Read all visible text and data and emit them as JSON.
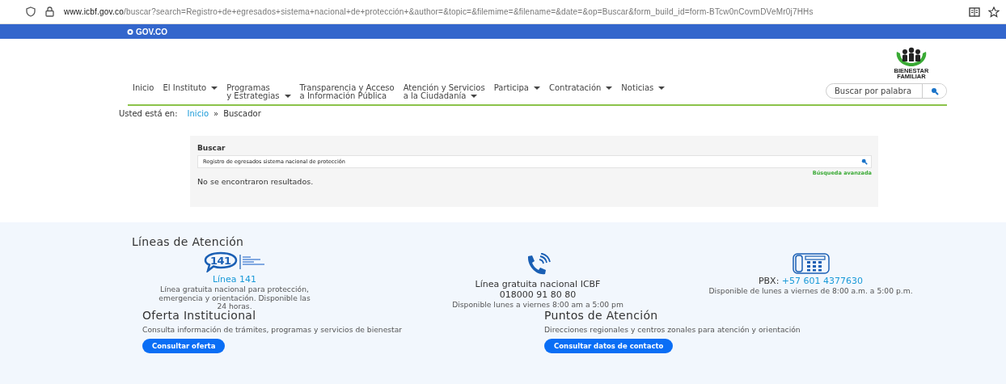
{
  "browser": {
    "url_domain": "www.icbf.gov.co",
    "url_rest": "/buscar?search=Registro+de+egresados+sistema+nacional+de+protección+&author=&topic=&filemime=&filename=&date=&op=Buscar&form_build_id=form-BTcw0nCovmDVeMr0j7HHs"
  },
  "gov_bar": {
    "logo_text": "GOV.CO"
  },
  "header": {
    "logo_text": "BIENESTAR FAMILIAR"
  },
  "nav": {
    "items": [
      {
        "label": "Inicio",
        "dropdown": false
      },
      {
        "label": "El Instituto",
        "dropdown": true
      },
      {
        "label": "Programas\ny Estrategias",
        "dropdown": true
      },
      {
        "label": "Transparencia y Acceso\na Información Pública",
        "dropdown": false
      },
      {
        "label": "Atención y Servicios\na la Ciudadanía",
        "dropdown": true
      },
      {
        "label": "Participa",
        "dropdown": true
      },
      {
        "label": "Contratación",
        "dropdown": true
      },
      {
        "label": "Noticias",
        "dropdown": true
      }
    ],
    "search_placeholder": "Buscar por palabra"
  },
  "breadcrumb": {
    "label": "Usted está en:",
    "items": [
      {
        "text": "Inicio",
        "link": true
      },
      {
        "text": "»",
        "link": false
      },
      {
        "text": "Buscador",
        "link": false
      }
    ]
  },
  "search_panel": {
    "title": "Buscar",
    "value": "Registro de egresados sistema nacional de protección",
    "advanced_link": "Búsqueda avanzada",
    "message": "No se encontraron resultados."
  },
  "footer": {
    "lines_title": "Líneas de Atención",
    "lines": [
      {
        "kind": "logo141",
        "logo_text": "141",
        "title_link": "Línea 141",
        "description": "Línea gratuita nacional para protección, emergencia y orientación. Disponible las 24 horas."
      },
      {
        "kind": "phone",
        "title": "Línea gratuita nacional ICBF",
        "number": "018000 91 80 80",
        "description": "Disponible lunes a viernes 8:00 am a 5:00 pm"
      },
      {
        "kind": "pbx",
        "title": "PBX: ",
        "title_link": "+57 601 4377630",
        "description": "Disponible de lunes a viernes de 8:00 a.m. a 5:00 p.m."
      }
    ],
    "sections": [
      {
        "title": "Oferta Institucional",
        "text": "Consulta información de trámites, programas y servicios de bienestar",
        "button": "Consultar oferta"
      },
      {
        "title": "Puntos de Atención",
        "text": "Direcciones regionales y centros zonales para atención y orientación",
        "button": "Consultar datos de contacto"
      }
    ]
  }
}
